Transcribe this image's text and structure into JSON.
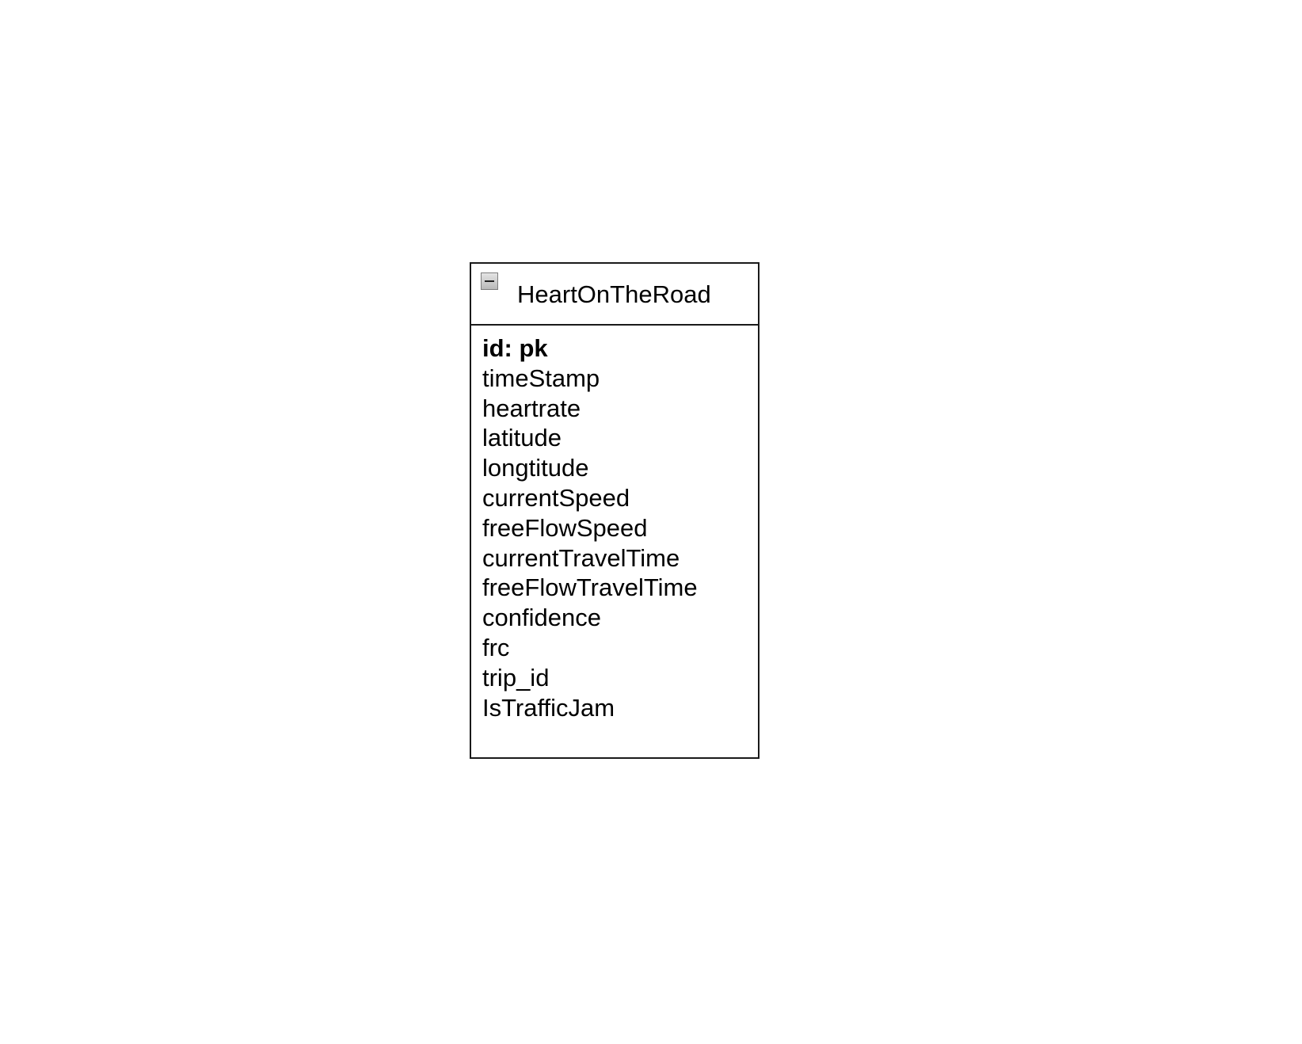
{
  "entity": {
    "title": "HeartOnTheRoad",
    "collapse_icon": "minus-icon",
    "primary_key": "id: pk",
    "attributes": [
      "timeStamp",
      "heartrate",
      "latitude",
      "longtitude",
      "currentSpeed",
      "freeFlowSpeed",
      "currentTravelTime",
      "freeFlowTravelTime",
      "confidence",
      "frc",
      "trip_id",
      "IsTrafficJam"
    ]
  }
}
